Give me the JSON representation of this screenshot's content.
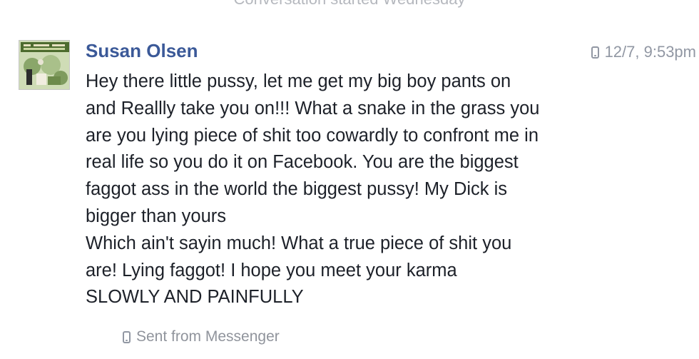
{
  "conversation": {
    "header": "Conversation started Wednesday"
  },
  "message": {
    "sender": "Susan Olsen",
    "timestamp": "12/7, 9:53pm",
    "lines": [
      "Hey there little pussy, let me get my big boy pants on",
      "and Reallly take you on!!! What a snake in the grass you",
      "are you lying piece of shit too cowardly to confront me in",
      "real life so you do it on Facebook. You are the biggest",
      "faggot ass in the world the biggest pussy! My Dick is",
      "bigger than yours",
      "Which ain't sayin much! What a true piece of shit you",
      "are! Lying faggot! I hope you meet your karma",
      "SLOWLY AND PAINFULLY"
    ],
    "footer": "Sent from Messenger"
  },
  "icons": {
    "timestamp_icon": "mobile-phone-icon",
    "footer_icon": "mobile-phone-icon"
  },
  "colors": {
    "sender_name": "#3b5998",
    "meta_text": "#9197a3",
    "body_text": "#1d2129"
  }
}
